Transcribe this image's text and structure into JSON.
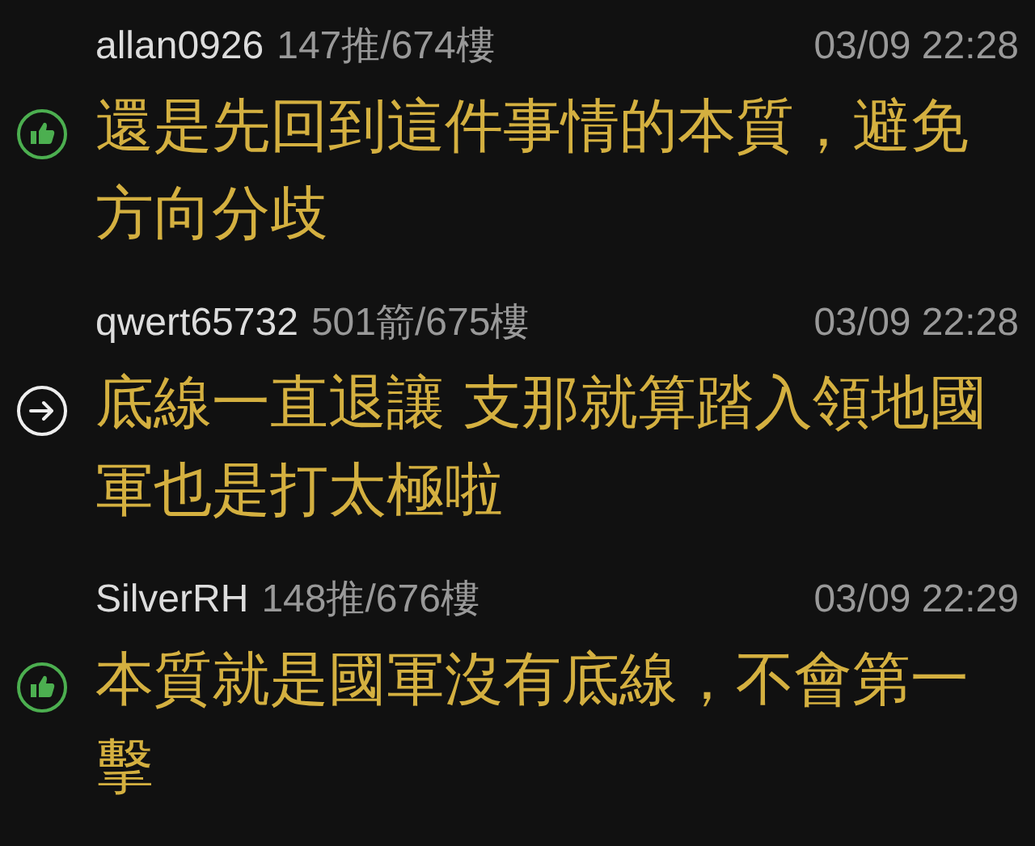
{
  "comments": [
    {
      "kind": "push",
      "user": "allan0926",
      "count": "147推/674樓",
      "time": "03/09 22:28",
      "text": "還是先回到這件事情的本質，避免方向分歧"
    },
    {
      "kind": "arrow",
      "user": "qwert65732",
      "count": "501箭/675樓",
      "time": "03/09 22:28",
      "text": "底線一直退讓 支那就算踏入領地國軍也是打太極啦"
    },
    {
      "kind": "push",
      "user": "SilverRH",
      "count": "148推/676樓",
      "time": "03/09 22:29",
      "text": "本質就是國軍沒有底線，不會第一擊"
    }
  ]
}
